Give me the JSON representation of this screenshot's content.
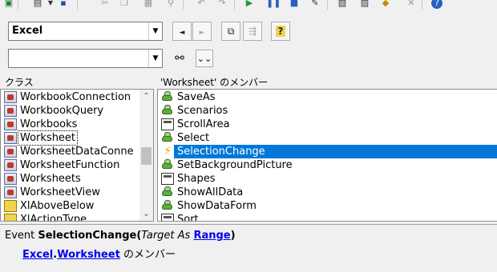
{
  "toolbar": {
    "icons": [
      "excel-icon",
      "insert-module-icon",
      "dropdown-arrow-icon",
      "save-icon",
      "cut-icon",
      "copy-icon",
      "paste-icon",
      "find-icon",
      "undo-icon",
      "redo-icon",
      "run-icon",
      "break-icon",
      "reset-icon",
      "design-mode-icon",
      "project-explorer-icon",
      "properties-icon",
      "object-browser-icon",
      "toolbox-icon",
      "help-icon"
    ]
  },
  "library": {
    "value": "Excel"
  },
  "search": {
    "value": ""
  },
  "buttons": {
    "back": "◄",
    "forward": "►"
  },
  "classes": {
    "label": "クラス",
    "items": [
      "WorkbookConnection",
      "WorkbookQuery",
      "Workbooks",
      "Worksheet",
      "WorksheetDataConne",
      "WorksheetFunction",
      "Worksheets",
      "WorksheetView",
      "XlAboveBelow",
      "XlActionType"
    ],
    "selected": 3
  },
  "members": {
    "label": "'Worksheet' のメンバー",
    "items": [
      {
        "name": "SaveAs",
        "kind": "method"
      },
      {
        "name": "Scenarios",
        "kind": "method"
      },
      {
        "name": "ScrollArea",
        "kind": "property"
      },
      {
        "name": "Select",
        "kind": "method"
      },
      {
        "name": "SelectionChange",
        "kind": "event"
      },
      {
        "name": "SetBackgroundPicture",
        "kind": "method"
      },
      {
        "name": "Shapes",
        "kind": "property"
      },
      {
        "name": "ShowAllData",
        "kind": "method"
      },
      {
        "name": "ShowDataForm",
        "kind": "method"
      },
      {
        "name": "Sort",
        "kind": "property"
      }
    ],
    "selected": 4
  },
  "details": {
    "prefix": "Event ",
    "name": "SelectionChange",
    "open_paren": "(",
    "param": "Target As ",
    "param_type": "Range",
    "close_paren": ")",
    "library_link": "Excel",
    "dot": ".",
    "class_link": "Worksheet",
    "suffix": " のメンバー"
  },
  "colors": {
    "selection": "#0078d7",
    "link": "#0000ee"
  }
}
